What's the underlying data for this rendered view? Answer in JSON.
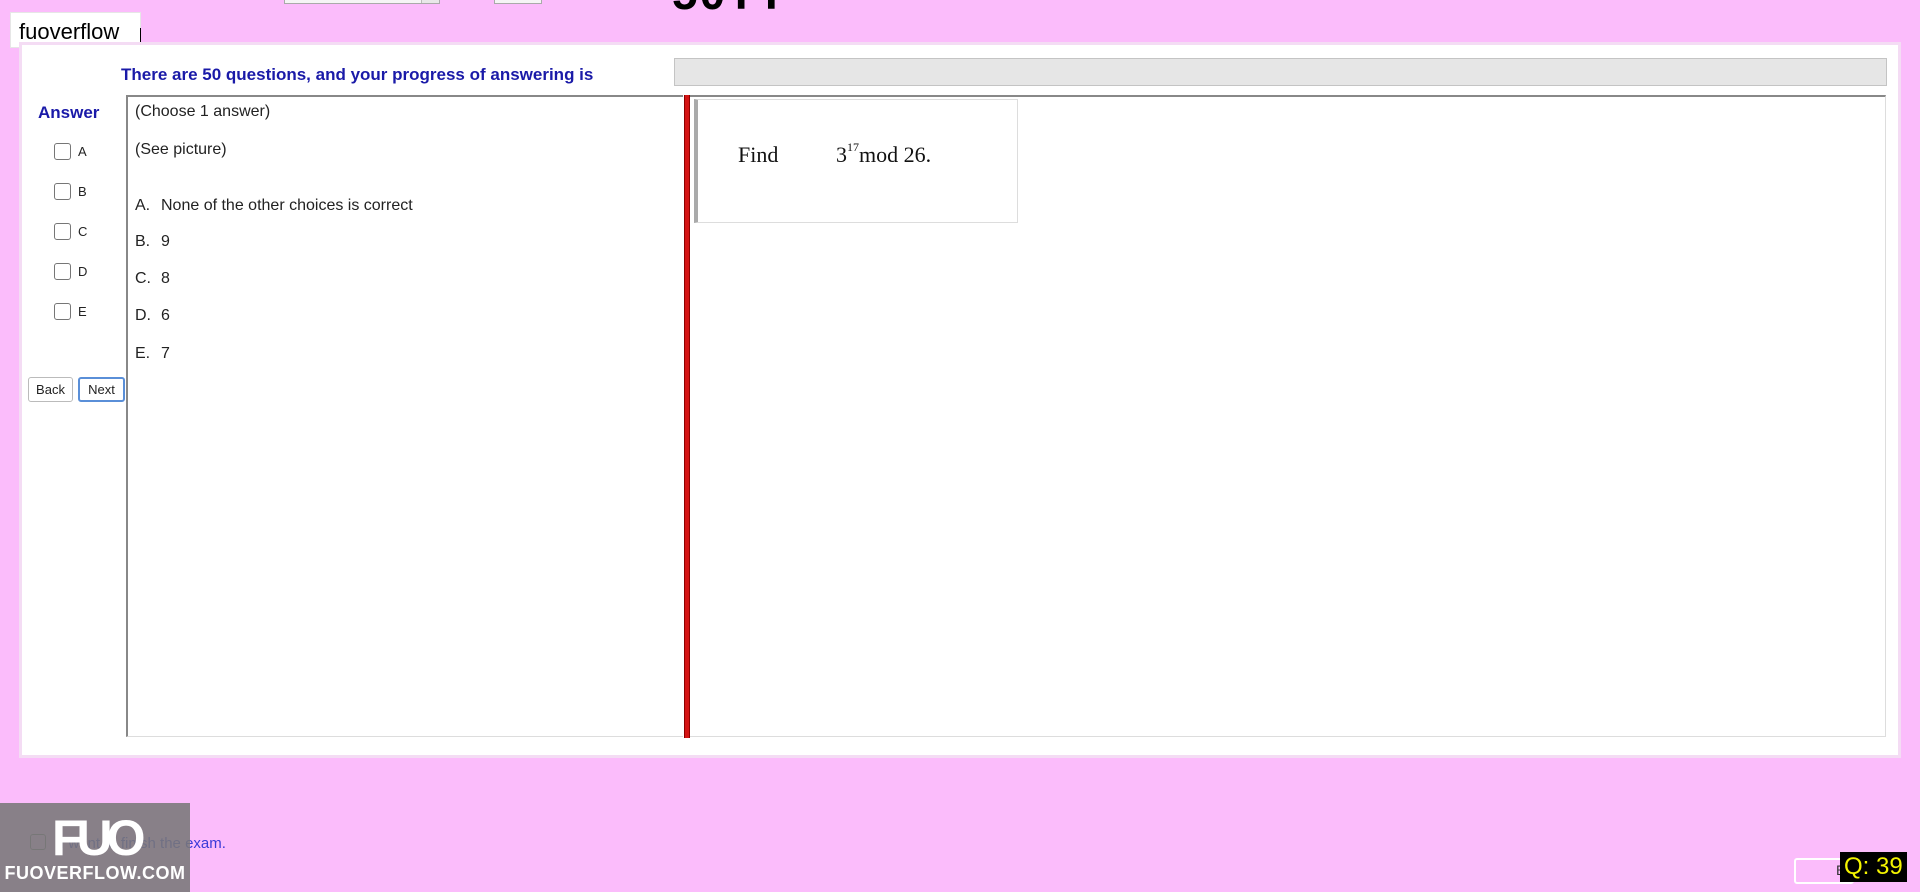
{
  "window": {
    "title": "fuoverflow",
    "top_partial_text": "50TT"
  },
  "header": {
    "progress_text": "There are 50 questions, and your progress of answering is",
    "progress_value": 0
  },
  "answer_panel": {
    "label": "Answer",
    "options": [
      "A",
      "B",
      "C",
      "D",
      "E"
    ]
  },
  "nav": {
    "back_label": "Back",
    "next_label": "Next"
  },
  "question": {
    "instruction": "(Choose 1 answer)",
    "note": "(See picture)",
    "choices": [
      {
        "letter": "A.",
        "text": "None of the other choices is correct"
      },
      {
        "letter": "B.",
        "text": "9"
      },
      {
        "letter": "C.",
        "text": "8"
      },
      {
        "letter": "D.",
        "text": "6"
      },
      {
        "letter": "E.",
        "text": "7"
      }
    ]
  },
  "picture": {
    "find_word": "Find",
    "base": "3",
    "exponent": "17",
    "rest": "mod 26."
  },
  "footer": {
    "finish_text": "I want to finish the exam.",
    "watermark_logo": "FUO",
    "watermark_text": "FUOVERFLOW.COM",
    "box_text": "E",
    "question_counter": "Q: 39"
  },
  "colors": {
    "background": "#fbbcfb",
    "heading_blue": "#1a1aa8",
    "splitter_red": "#d41414",
    "counter_text": "#f4f400"
  }
}
